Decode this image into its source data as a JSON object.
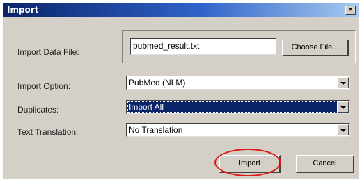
{
  "window": {
    "title": "Import",
    "close_glyph": "×"
  },
  "form": {
    "import_data_file": {
      "label": "Import Data File:",
      "value": "pubmed_result.txt"
    },
    "choose_file_button": "Choose File...",
    "import_option": {
      "label": "Import Option:",
      "value": "PubMed (NLM)"
    },
    "duplicates": {
      "label": "Duplicates:",
      "value": "Import All"
    },
    "text_translation": {
      "label": "Text Translation:",
      "value": "No Translation"
    }
  },
  "buttons": {
    "import": "Import",
    "cancel": "Cancel"
  },
  "colors": {
    "titlebar": "#0a246a",
    "dialog_face": "#d4d0c8",
    "selection": "#0a246a",
    "highlight_ring": "#e01818"
  }
}
